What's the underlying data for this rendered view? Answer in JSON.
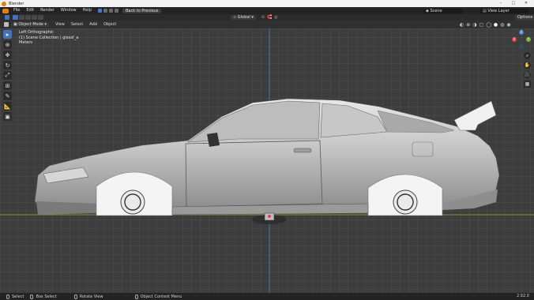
{
  "window": {
    "title": "Blender",
    "minimize": "–",
    "maximize": "□",
    "close": "✕"
  },
  "menubar": {
    "items": [
      "File",
      "Edit",
      "Render",
      "Window",
      "Help"
    ],
    "back_button": "Back to Previous",
    "scene": "Scene",
    "view_layer": "View Layer"
  },
  "header": {
    "mode": "Object Mode",
    "menus": [
      "View",
      "Select",
      "Add",
      "Object"
    ],
    "transform_orientation": "Global",
    "options": "Options"
  },
  "overlay": {
    "view_name": "Left Orthographic",
    "collection": "(1) Scene Collection | glassf_a",
    "units": "Meters"
  },
  "gizmo": {
    "z": "Z",
    "y": "Y",
    "x": "X"
  },
  "status": {
    "select": "Select",
    "box_select": "Box Select",
    "rotate_view": "Rotate View",
    "context_menu": "Object Context Menu",
    "version": "2.92.0"
  },
  "colors": {
    "accent": "#4772b3",
    "brand": "#e87d0d",
    "axis_red": "#e0424c",
    "axis_green": "#76b043",
    "axis_blue": "#4a83d4"
  }
}
